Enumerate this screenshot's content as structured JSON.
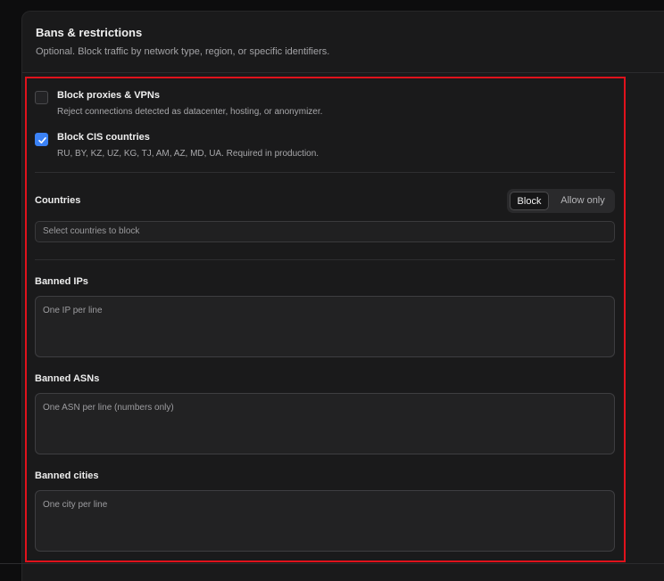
{
  "section": {
    "title": "Bans & restrictions",
    "subtitle": "Optional. Block traffic by network type, region, or specific identifiers."
  },
  "options": [
    {
      "label": "Block proxies & VPNs",
      "description": "Reject connections detected as datacenter, hosting, or anonymizer.",
      "checked": false
    },
    {
      "label": "Block CIS countries",
      "description": "RU, BY, KZ, UZ, KG, TJ, AM, AZ, MD, UA. Required in production.",
      "checked": true
    }
  ],
  "countries": {
    "label": "Countries",
    "mode_options": [
      "Block",
      "Allow only"
    ],
    "selected_mode": "Block",
    "placeholder": "Select countries to block"
  },
  "banned_ips": {
    "label": "Banned IPs",
    "placeholder": "One IP per line"
  },
  "banned_asns": {
    "label": "Banned ASNs",
    "placeholder": "One ASN per line (numbers only)"
  },
  "banned_cities": {
    "label": "Banned cities",
    "placeholder": "One city per line"
  },
  "colors": {
    "accent": "#3b82f6",
    "highlight": "#e0121c",
    "background": "#1a1a1b"
  }
}
